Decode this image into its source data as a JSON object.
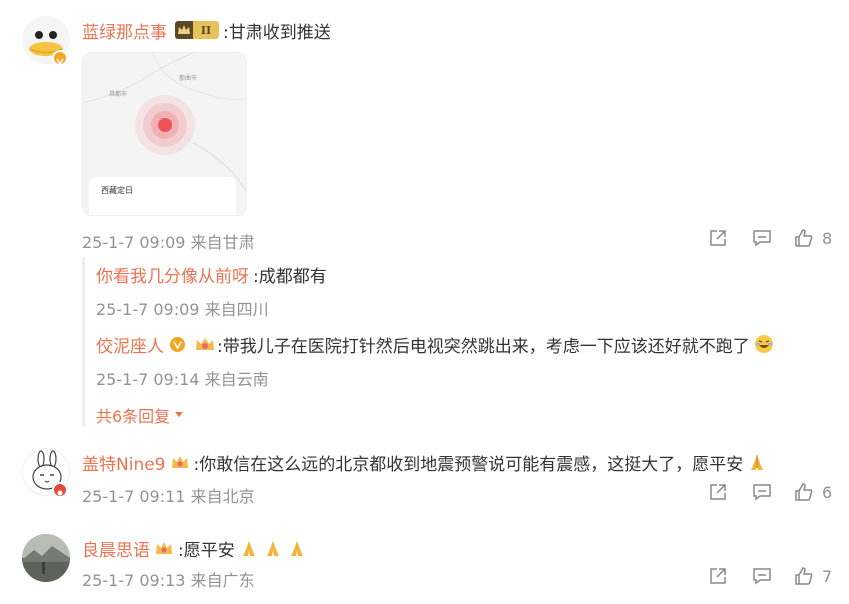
{
  "comments": [
    {
      "user": "蓝绿那点事",
      "text": ":甘肃收到推送",
      "level_badge": "II",
      "map": {
        "labels": [
          "昌都市",
          "那曲市"
        ],
        "footer": "西藏定日"
      },
      "time": "25-1-7 09:09",
      "location": "来自甘肃",
      "likes": "8"
    },
    {
      "user": "盖特Nine9",
      "text": ":你敢信在这么远的北京都收到地震预警说可能有震感，这挺大了，愿平安",
      "time": "25-1-7 09:11",
      "location": "来自北京",
      "likes": "6"
    },
    {
      "user": "良晨思语",
      "text": ":愿平安",
      "time": "25-1-7 09:13",
      "location": "来自广东",
      "likes": "7"
    }
  ],
  "replies": [
    {
      "user": "你看我几分像从前呀",
      "text": ":成都都有",
      "time": "25-1-7 09:09",
      "location": "来自四川"
    },
    {
      "user": "佼泥座人",
      "text": ":带我儿子在医院打针然后电视突然跳出来，考虑一下应该还好就不跑了",
      "time": "25-1-7 09:14",
      "location": "来自云南"
    }
  ],
  "more_replies": "共6条回复",
  "icons": [
    "share-icon",
    "comment-icon",
    "like-icon",
    "pray-emoji",
    "laugh-cry-emoji",
    "crown-badge",
    "verified-badge"
  ],
  "colors": {
    "username": "#eb7350",
    "meta": "#939393",
    "text": "#333333",
    "pulse": "#f0525a"
  }
}
